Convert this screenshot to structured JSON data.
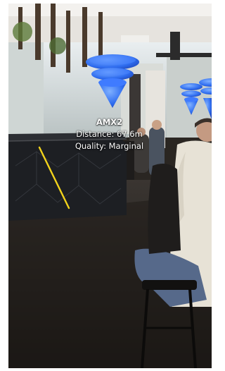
{
  "ar_marker": {
    "name": "AMX2",
    "distance": "Distance: 67.6m",
    "quality": "Quality: Marginal"
  },
  "icons": {
    "primary_signal": "wifi-signal-cone-icon",
    "secondary_signal": "wifi-signal-cone-icon"
  },
  "colors": {
    "signal_blue": "#2f6df0",
    "laser_line": "#f2d31b",
    "label_text": "#ffffff"
  }
}
